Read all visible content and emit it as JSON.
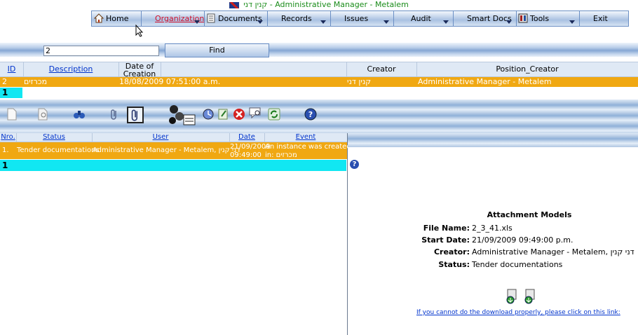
{
  "header": {
    "title": "קנין דני - Administrative Manager - Metalem"
  },
  "menu": [
    {
      "label": "Home",
      "icon": "home-icon"
    },
    {
      "label": "Organization",
      "icon": "",
      "active": true
    },
    {
      "label": "Documents",
      "icon": "documents-icon"
    },
    {
      "label": "Records",
      "icon": ""
    },
    {
      "label": "Issues",
      "icon": ""
    },
    {
      "label": "Audit",
      "icon": ""
    },
    {
      "label": "Smart Docs",
      "icon": ""
    },
    {
      "label": "Tools",
      "icon": "tools-icon"
    },
    {
      "label": "Exit",
      "icon": ""
    }
  ],
  "search": {
    "value": "2",
    "find_label": "Find"
  },
  "grid1": {
    "columns": [
      "ID",
      "Description",
      "Date of Creation",
      "Creator",
      "Position_Creator"
    ],
    "rows": [
      {
        "id": "2",
        "description": "מכרזים",
        "date": "18/08/2009 07:51:00 a.m.",
        "creator": "קנין דני",
        "position": "Administrative Manager - Metalem"
      }
    ],
    "page": "1"
  },
  "grid2": {
    "columns": [
      "Nro.",
      "Status",
      "User",
      "Date",
      "Event"
    ],
    "rows": [
      {
        "nro": "1.",
        "status": "Tender documentations",
        "user": "Administrative Manager - Metalem, דני קנין",
        "date_line1": "21/09/2009",
        "date_line2": "09:49:00",
        "event_line1": "An instance was created",
        "event_line2": "in: מכרזים"
      }
    ],
    "page": "1"
  },
  "attachment": {
    "title": "Attachment Models",
    "file_name_label": "File Name:",
    "file_name": "2_3_41.xls",
    "start_date_label": "Start Date:",
    "start_date": "21/09/2009 09:49:00 p.m.",
    "creator_label": "Creator:",
    "creator": "Administrative Manager - Metalem, דני קנין",
    "status_label": "Status:",
    "status": "Tender documentations",
    "download_link": "If you cannot do the download properly, please click on this link:"
  },
  "help_glyph": "?",
  "colors": {
    "row_highlight": "#f0a812",
    "pager": "#11e7f2",
    "link": "#0033cc",
    "title_green": "#1a8c1a"
  }
}
